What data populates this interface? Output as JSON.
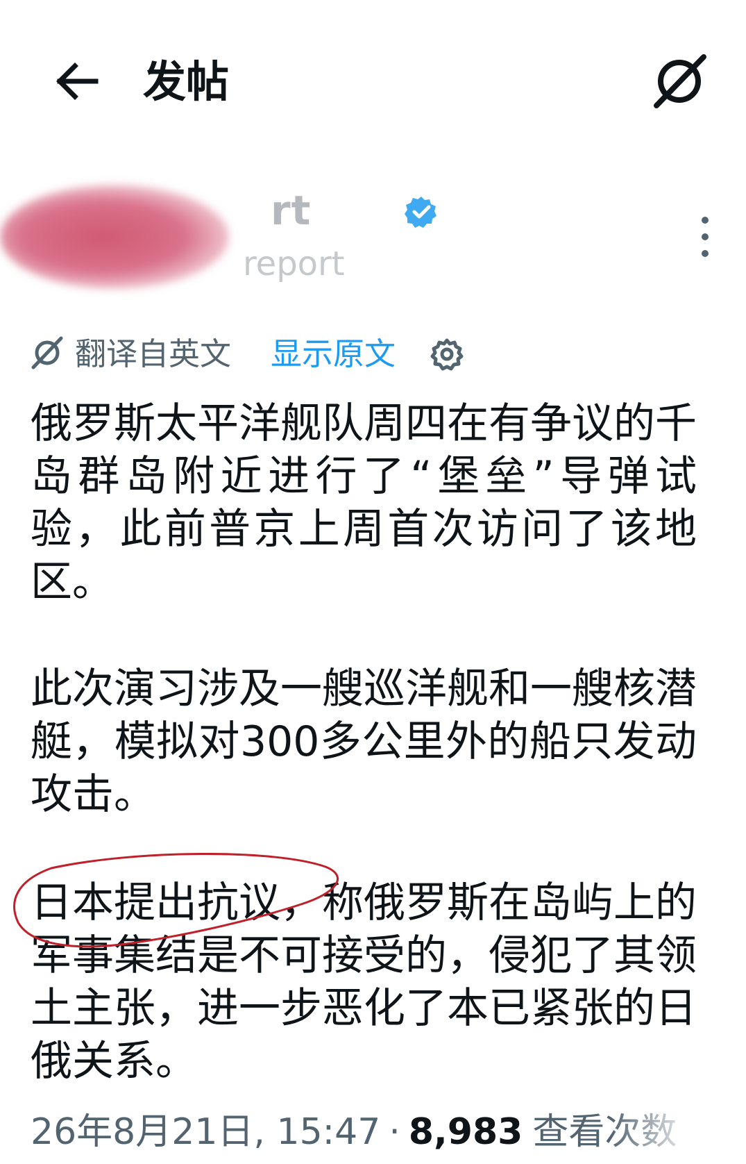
{
  "header": {
    "title": "发帖"
  },
  "author": {
    "display_name": "rt",
    "handle": "report"
  },
  "translation": {
    "translated_from": "翻译自英文",
    "show_original": "显示原文"
  },
  "post": {
    "paragraphs": [
      "俄罗斯太平洋舰队周四在有争议的千岛群岛附近进行了“堡垒”导弹试验，此前普京上周首次访问了该地区。",
      "此次演习涉及一艘巡洋舰和一艘核潜艇，模拟对300多公里外的船只发动攻击。",
      "日本提出抗议，称俄罗斯在岛屿上的军事集结是不可接受的，侵犯了其领土主张，进一步恶化了本已紧张的日俄关系。"
    ]
  },
  "meta": {
    "timestamp": "26年8月21日, 15:47",
    "separator": "·",
    "views_count": "8,983",
    "views_label": "查看次数"
  },
  "colors": {
    "text": "#0f1419",
    "secondary": "#536471",
    "link": "#1d9bf0",
    "verified": "#1d9bf0",
    "annotation": "#c0202a",
    "avatar_blur": "#d05a72"
  },
  "icons": {
    "back": "arrow-left-icon",
    "grok": "grok-icon",
    "verified": "verified-badge-icon",
    "more": "more-vertical-icon",
    "translate": "grok-icon",
    "settings": "gear-icon"
  }
}
